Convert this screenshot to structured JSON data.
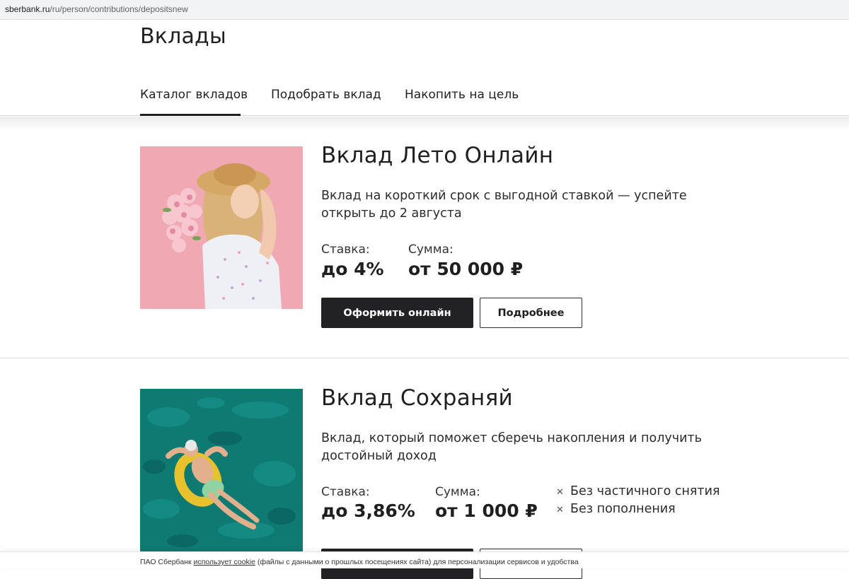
{
  "browser": {
    "url_host": "sberbank.ru",
    "url_path": "/ru/person/contributions/depositsnew"
  },
  "page": {
    "title": "Вклады"
  },
  "tabs": [
    {
      "label": "Каталог вкладов",
      "active": true
    },
    {
      "label": "Подобрать вклад",
      "active": false
    },
    {
      "label": "Накопить на цель",
      "active": false
    }
  ],
  "cards": [
    {
      "title": "Вклад Лето Онлайн",
      "description": "Вклад на короткий срок с выгодной ставкой — успейте открыть до 2 августа",
      "rate_label": "Ставка:",
      "rate_value": "до 4%",
      "sum_label": "Сумма:",
      "sum_value": "от 50 000 ₽",
      "primary_button": "Оформить онлайн",
      "secondary_button": "Подробнее"
    },
    {
      "title": "Вклад Сохраняй",
      "description": "Вклад, который поможет сберечь накопления и получить достойный доход",
      "rate_label": "Ставка:",
      "rate_value": "до 3,86%",
      "sum_label": "Сумма:",
      "sum_value": "от 1 000 ₽",
      "features": [
        "Без частичного снятия",
        "Без пополнения"
      ],
      "feature_icon": "cross-icon"
    }
  ],
  "cookie": {
    "prefix": "ПАО Сбербанк",
    "link": "использует cookie",
    "suffix": "(файлы с данными о прошлых посещениях сайта) для персонализации сервисов и удобства"
  },
  "colors": {
    "primary_dark": "#222225",
    "card1_bg": "#f0a8b2",
    "card2_bg": "#0f7a72"
  }
}
